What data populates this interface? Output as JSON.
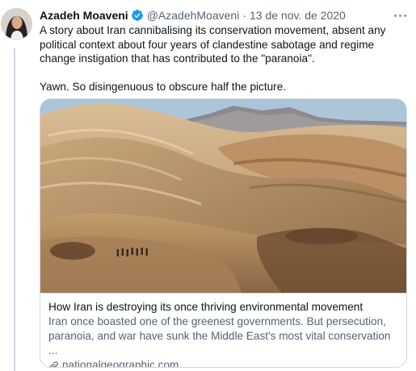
{
  "tweet": {
    "display_name": "Azadeh Moaveni",
    "handle": "@AzadehMoaveni",
    "separator": "·",
    "date": "13 de nov. de 2020",
    "text_p1": "A story about Iran cannibalising its conservation movement, absent any political context about four years of clandestine sabotage and regime change instigation that has contributed to the \"paranoia\".",
    "text_p2": "Yawn. So disingenuous to obscure half the picture."
  },
  "card": {
    "title": "How Iran is destroying its once thriving environmental movement",
    "description": "Iran once boasted one of the greenest governments. But persecution, paranoia, and war have sunk the Middle East's most vital conservation ...",
    "domain": "nationalgeographic.com"
  },
  "icons": {
    "verified": "verified-badge-icon",
    "more": "more-options-icon",
    "link": "link-icon"
  },
  "colors": {
    "verified": "#1d9bf0",
    "text": "#0f1419",
    "secondary": "#536471",
    "border": "#cfd9de"
  }
}
